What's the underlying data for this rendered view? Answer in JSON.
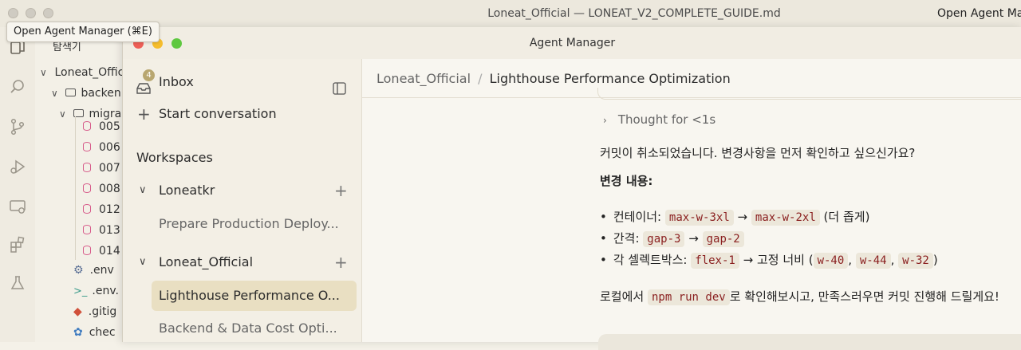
{
  "outer_window": {
    "title": "Loneat_Official — LONEAT_V2_COMPLETE_GUIDE.md",
    "right_button": "Open Agent Manager",
    "tooltip": "Open Agent Manager (⌘E)"
  },
  "explorer": {
    "header": "탐색기",
    "root": "Loneat_Offic",
    "folder_backend": "backen",
    "folder_migrations": "migra",
    "files": [
      "005",
      "006",
      "007",
      "008",
      "012",
      "013",
      "014"
    ],
    "env": ".env",
    "env2": ".env.",
    "gitignore": ".gitig",
    "check": "chec"
  },
  "agent_manager": {
    "title": "Agent Manager",
    "sidebar": {
      "inbox_label": "Inbox",
      "inbox_count": "4",
      "start_conversation": "Start conversation",
      "workspaces_label": "Workspaces",
      "workspace1": {
        "name": "Loneatkr",
        "items": [
          "Prepare Production Deploy..."
        ]
      },
      "workspace2": {
        "name": "Loneat_Official",
        "items": [
          "Lighthouse Performance O...",
          "Backend & Data Cost Opti..."
        ]
      }
    },
    "breadcrumb": {
      "root": "Loneat_Official",
      "separator": "/",
      "current": "Lighthouse Performance Optimization"
    },
    "conversation": {
      "thought": "Thought for <1s",
      "line1": "커밋이 취소되었습니다. 변경사항을 먼저 확인하고 싶으신가요?",
      "changes_header": "변경 내용:",
      "b1_label": "컨테이너:",
      "b1_code1": "max-w-3xl",
      "b1_code2": "max-w-2xl",
      "b1_note": "(더 좁게)",
      "b2_label": "간격:",
      "b2_code1": "gap-3",
      "b2_code2": "gap-2",
      "b3_label": "각 셀렉트박스:",
      "b3_code1": "flex-1",
      "b3_mid": "고정 너비 (",
      "b3_code2": "w-40",
      "b3_code3": "w-44",
      "b3_code4": "w-32",
      "b3_end": ")",
      "arrow": "→",
      "comma": ",",
      "bullet": "•",
      "final_pre": "로컬에서",
      "final_code": "npm run dev",
      "final_post": "로 확인해보시고, 만족스러우면 커밋 진행해 드릴게요!"
    }
  }
}
